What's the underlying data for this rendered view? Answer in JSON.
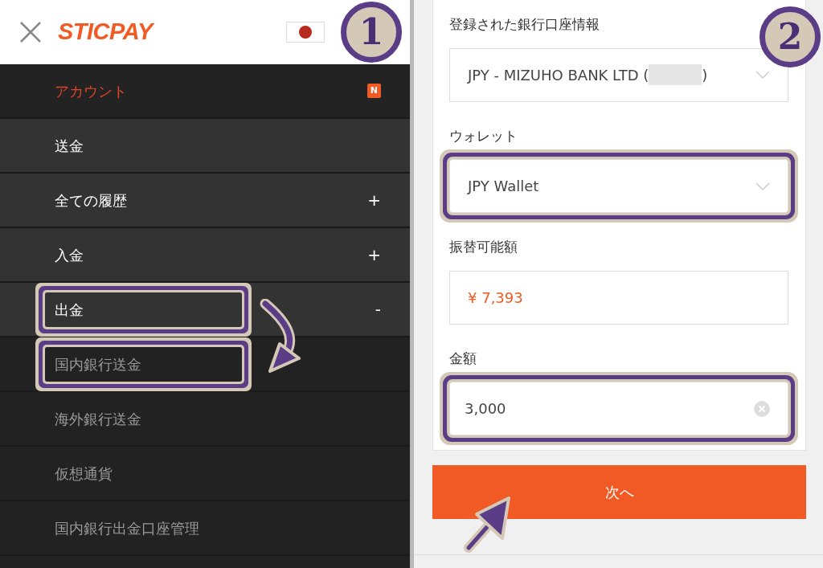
{
  "left_screen": {
    "header": {
      "logo": "STICPAY",
      "step_badge": "1"
    },
    "menu": [
      {
        "label": "アカウント",
        "kind": "top",
        "active": true,
        "badge": "N",
        "highlighted": false
      },
      {
        "label": "送金",
        "kind": "top",
        "active": false,
        "highlighted": false
      },
      {
        "label": "全ての履歴",
        "kind": "top",
        "active": false,
        "sign": "+",
        "highlighted": false
      },
      {
        "label": "入金",
        "kind": "top",
        "active": false,
        "sign": "+",
        "highlighted": false
      },
      {
        "label": "出金",
        "kind": "top",
        "active": false,
        "sign": "-",
        "highlighted": true
      },
      {
        "label": "国内銀行送金",
        "kind": "sub",
        "active": false,
        "highlighted": true
      },
      {
        "label": "海外銀行送金",
        "kind": "sub",
        "active": false,
        "highlighted": false
      },
      {
        "label": "仮想通貨",
        "kind": "sub",
        "active": false,
        "highlighted": false
      },
      {
        "label": "国内銀行出金口座管理",
        "kind": "sub",
        "active": false,
        "highlighted": false
      }
    ]
  },
  "right_screen": {
    "step_badge": "2",
    "fields": [
      {
        "label": "登録された銀行口座情報",
        "kind": "select",
        "value": "JPY - MIZUHO BANK LTD (",
        "value_suffix": ")",
        "redacted": true,
        "highlighted": false
      },
      {
        "label": "ウォレット",
        "kind": "select",
        "value": "JPY Wallet",
        "highlighted": true
      },
      {
        "label": "振替可能額",
        "kind": "display",
        "value": "¥ 7,393",
        "highlighted": false
      },
      {
        "label": "金額",
        "kind": "input",
        "value": "3,000",
        "highlighted": true
      }
    ],
    "next_button": "次へ"
  }
}
